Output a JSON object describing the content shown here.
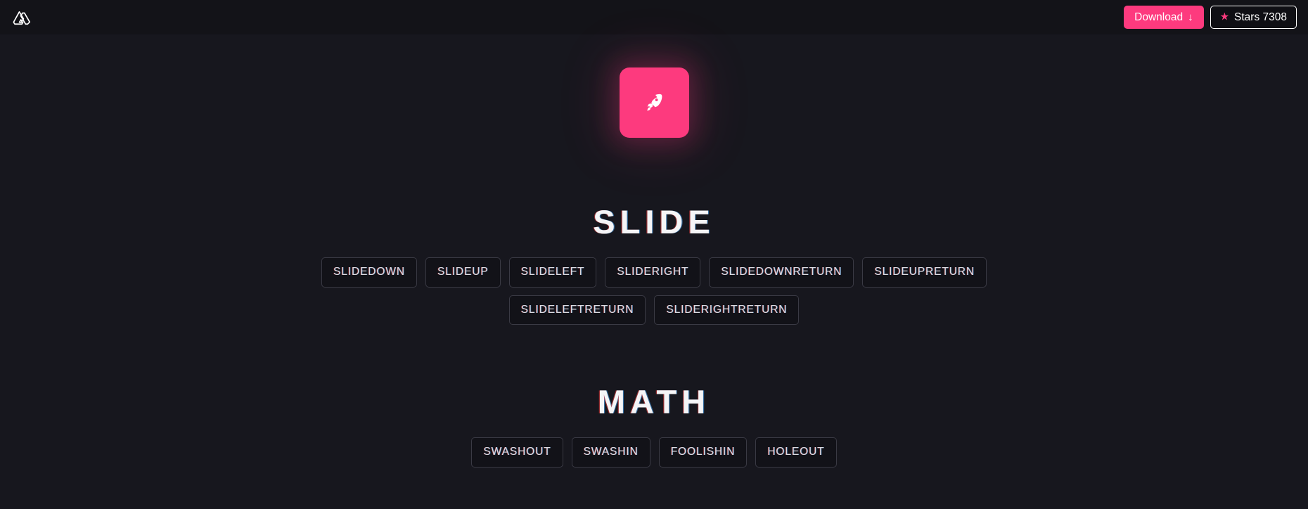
{
  "header": {
    "logo_icon": "nuxt-logo-icon",
    "download": {
      "label": "Download",
      "arrow": "↓",
      "icon": "download-arrow-icon",
      "color": "#fd3a7e"
    },
    "stars": {
      "icon": "star-icon",
      "glyph": "★",
      "label": "Stars 7308",
      "count": "7308",
      "star_color": "#fd3a7e"
    }
  },
  "hero": {
    "icon": "rocket-icon",
    "tile_color": "#fd3a7e"
  },
  "sections": [
    {
      "title": "SLIDE",
      "rows": [
        [
          "SLIDEDOWN",
          "SLIDEUP",
          "SLIDELEFT",
          "SLIDERIGHT",
          "SLIDEDOWNRETURN",
          "SLIDEUPRETURN"
        ],
        [
          "SLIDELEFTRETURN",
          "SLIDERIGHTRETURN"
        ]
      ]
    },
    {
      "title": "MATH",
      "rows": [
        [
          "SWASHOUT",
          "SWASHIN",
          "FOOLISHIN",
          "HOLEOUT"
        ]
      ]
    }
  ],
  "theme": {
    "page_bg": "#17171e",
    "header_bg": "#131318",
    "accent": "#fd3a7e",
    "chip_bg": "#121218",
    "chip_border": "#3a3a44",
    "text": "#e6e6ea"
  }
}
